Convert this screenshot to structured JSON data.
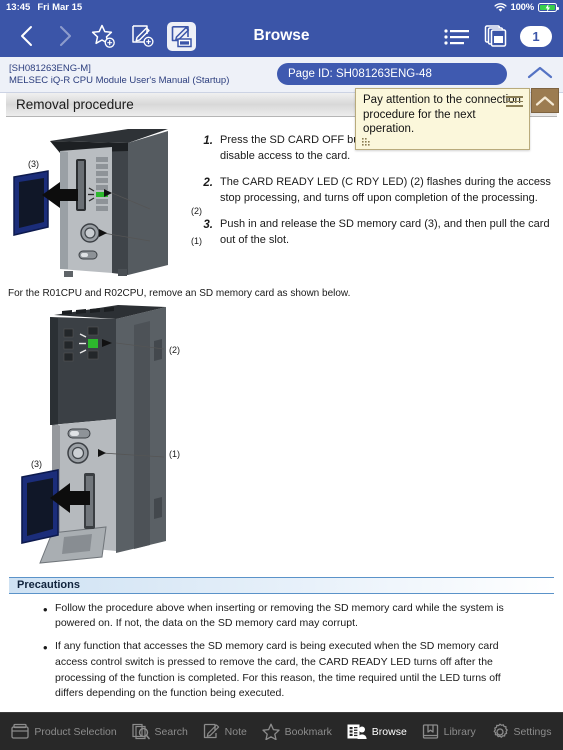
{
  "statusbar": {
    "time": "13:45",
    "date": "Fri Mar 15",
    "battery_pct": "100%",
    "wifi_icon": "wifi-icon",
    "battery_icon": "battery-charging-icon"
  },
  "navbar": {
    "title": "Browse",
    "tab_count": "1",
    "buttons": [
      {
        "name": "back-button",
        "icon": "chevron-left-icon",
        "enabled": true
      },
      {
        "name": "forward-button",
        "icon": "chevron-right-icon",
        "enabled": false
      },
      {
        "name": "add-bookmark-button",
        "icon": "star-plus-icon",
        "enabled": true
      },
      {
        "name": "add-note-button",
        "icon": "note-plus-icon",
        "enabled": true
      },
      {
        "name": "show-notes-button",
        "icon": "note-window-icon",
        "enabled": true
      }
    ],
    "right_buttons": [
      {
        "name": "toc-list-button",
        "icon": "list-icon"
      },
      {
        "name": "tabs-button",
        "icon": "copy-pages-icon"
      }
    ]
  },
  "docbar": {
    "doc_code": "[SH081263ENG-M]",
    "doc_name": "MELSEC iQ-R CPU Module User's Manual (Startup)",
    "page_id": "Page ID: SH081263ENG-48",
    "collapse_icon": "chevron-up-icon"
  },
  "document": {
    "section_title": "Removal procedure",
    "steps": [
      {
        "num": "1.",
        "text": "Press the SD CARD OFF button (1) for one second or longer to disable access to the card."
      },
      {
        "num": "2.",
        "text": "The CARD READY LED (C RDY LED) (2) flashes during the access stop processing, and turns off upon completion of the processing."
      },
      {
        "num": "3.",
        "text": "Push in and release the SD memory card (3), and then pull the card out of the slot."
      }
    ],
    "note_paragraph": "For the R01CPU and R02CPU, remove an SD memory card as shown below.",
    "figure1": {
      "name": "cpu-module-sd-removal-figure-1",
      "callouts": [
        "(1)",
        "(2)",
        "(3)"
      ]
    },
    "figure2": {
      "name": "r01cpu-sd-removal-figure-2",
      "callouts": [
        "(1)",
        "(2)",
        "(3)"
      ]
    },
    "precautions_title": "Precautions",
    "precautions": [
      "Follow the procedure above when inserting or removing the SD memory card while the system is powered on. If not, the data on the SD memory card may corrupt.",
      "If any function that accesses the SD memory card is being executed when the SD memory card access control switch is pressed to remove the card, the CARD READY LED turns off after the processing of the function is completed. For this reason, the time required until the LED turns off differs depending on the function being executed."
    ]
  },
  "note_popup": {
    "text": "Pay attention to the connection procedure for the next operation.",
    "menu_icon": "hamburger-menu-icon",
    "collapse_icon": "chevron-up-icon",
    "resize_icon": "resize-grip-icon"
  },
  "toolbar": {
    "items": [
      {
        "label": "Product Selection",
        "icon": "product-box-icon",
        "name": "toolbar-product-selection",
        "selected": false
      },
      {
        "label": "Search",
        "icon": "search-docs-icon",
        "name": "toolbar-search",
        "selected": false
      },
      {
        "label": "Note",
        "icon": "note-pencil-icon",
        "name": "toolbar-note",
        "selected": false
      },
      {
        "label": "Bookmark",
        "icon": "star-icon",
        "name": "toolbar-bookmark",
        "selected": false
      },
      {
        "label": "Browse",
        "icon": "browse-book-icon",
        "name": "toolbar-browse",
        "selected": true
      },
      {
        "label": "Library",
        "icon": "library-book-icon",
        "name": "toolbar-library",
        "selected": false
      },
      {
        "label": "Settings",
        "icon": "gear-icon",
        "name": "toolbar-settings",
        "selected": false
      }
    ]
  },
  "colors": {
    "nav_blue": "#3b55a8",
    "docbar_bg": "#eef1f8",
    "pill_blue": "#3f5ab0",
    "note_yellow": "#fbf7db",
    "note_brown": "#9c7c51",
    "toolbar_dark": "#282828",
    "battery_green": "#37d04a",
    "led_green": "#2db82d",
    "sd_card_blue": "#1b2d7a"
  }
}
